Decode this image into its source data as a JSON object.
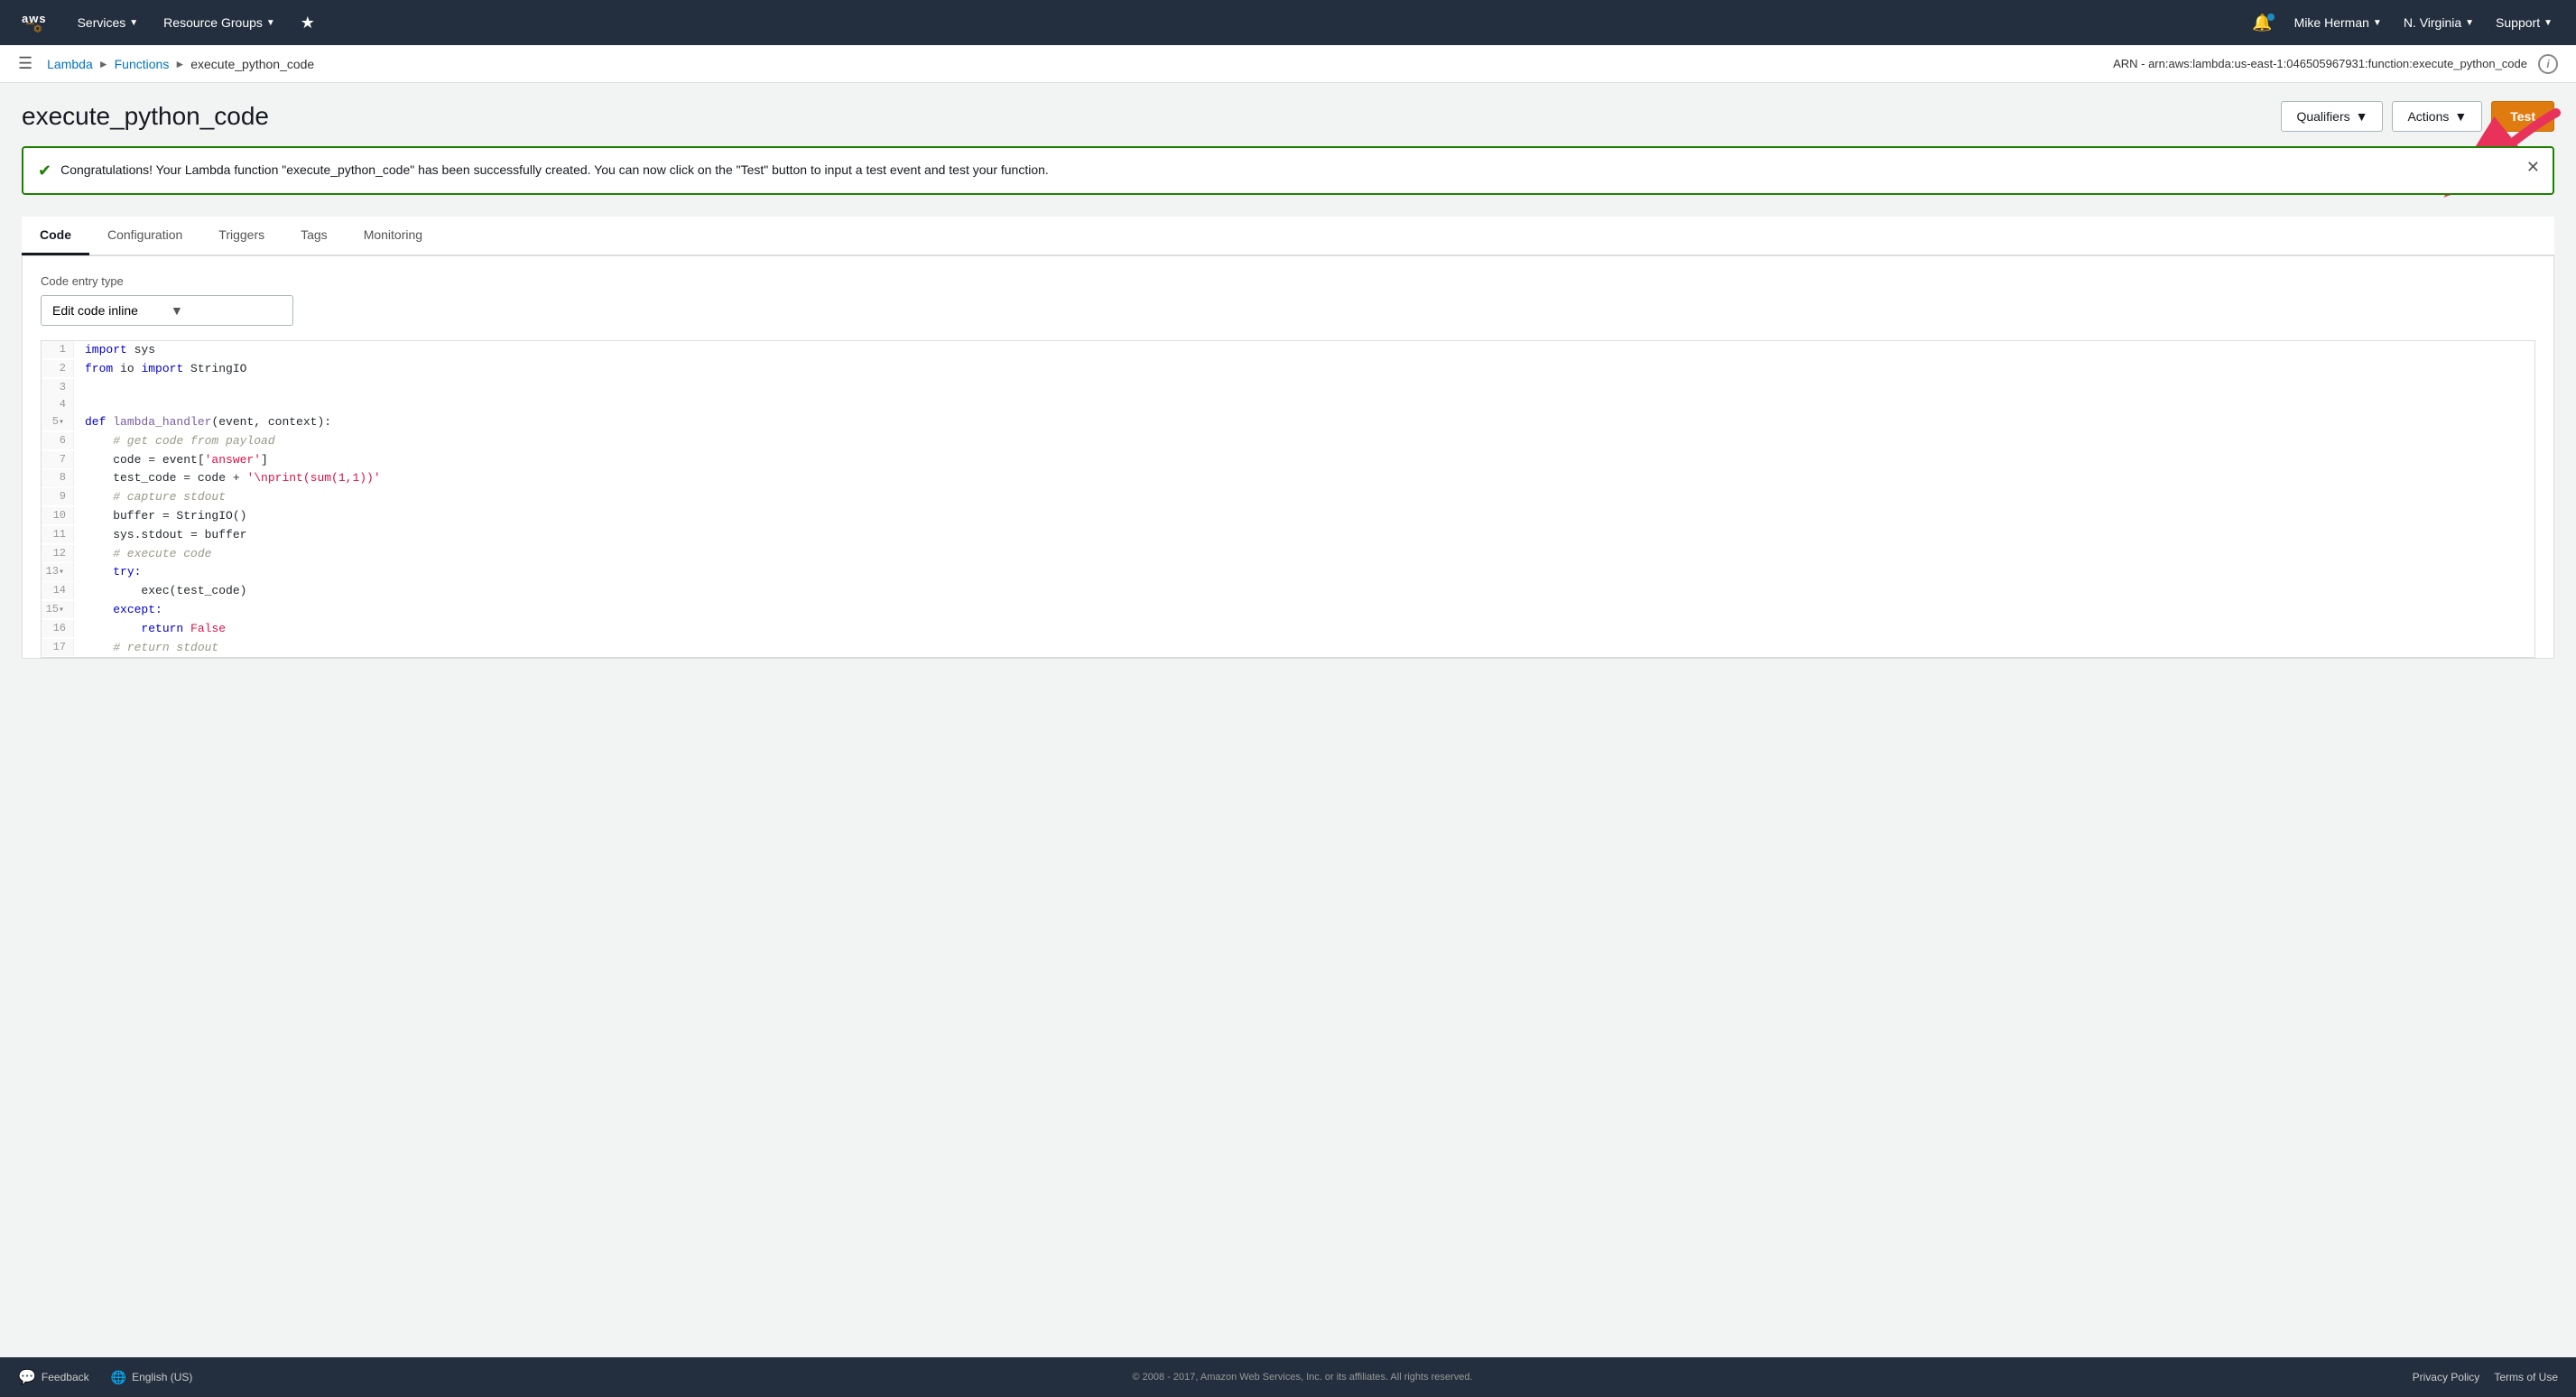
{
  "topnav": {
    "services_label": "Services",
    "resource_groups_label": "Resource Groups",
    "bell_count": "",
    "user_name": "Mike Herman",
    "region": "N. Virginia",
    "support": "Support"
  },
  "breadcrumb": {
    "lambda": "Lambda",
    "functions": "Functions",
    "current": "execute_python_code"
  },
  "arn": "ARN - arn:aws:lambda:us-east-1:046505967931:function:execute_python_code",
  "page": {
    "title": "execute_python_code",
    "qualifiers_btn": "Qualifiers",
    "actions_btn": "Actions",
    "test_btn": "Test"
  },
  "success_banner": {
    "text": "Congratulations! Your Lambda function \"execute_python_code\" has been successfully created. You can now click on the \"Test\" button to input a test event and test your function."
  },
  "tabs": [
    {
      "label": "Code",
      "active": true
    },
    {
      "label": "Configuration",
      "active": false
    },
    {
      "label": "Triggers",
      "active": false
    },
    {
      "label": "Tags",
      "active": false
    },
    {
      "label": "Monitoring",
      "active": false
    }
  ],
  "code_panel": {
    "entry_type_label": "Code entry type",
    "entry_type_value": "Edit code inline"
  },
  "code_lines": [
    {
      "num": "1",
      "content": "import sys",
      "tokens": [
        {
          "t": "kw-blue",
          "v": "import"
        },
        {
          "t": "",
          "v": " sys"
        }
      ]
    },
    {
      "num": "2",
      "content": "from io import StringIO",
      "tokens": [
        {
          "t": "kw-blue",
          "v": "from"
        },
        {
          "t": "",
          "v": " io "
        },
        {
          "t": "kw-blue",
          "v": "import"
        },
        {
          "t": "",
          "v": " StringIO"
        }
      ]
    },
    {
      "num": "3",
      "content": "",
      "tokens": []
    },
    {
      "num": "4",
      "content": "",
      "tokens": []
    },
    {
      "num": "5",
      "content": "def lambda_handler(event, context):",
      "fold": true,
      "tokens": [
        {
          "t": "kw-blue",
          "v": "def"
        },
        {
          "t": "",
          "v": " lambda_handler(event, context):"
        }
      ]
    },
    {
      "num": "6",
      "content": "    # get code from payload",
      "tokens": [
        {
          "t": "kw-comment",
          "v": "    # get code from payload"
        }
      ]
    },
    {
      "num": "7",
      "content": "    code = event['answer']",
      "tokens": [
        {
          "t": "",
          "v": "    code = event["
        },
        {
          "t": "kw-string",
          "v": "'answer'"
        },
        {
          "t": "",
          "v": "]"
        }
      ]
    },
    {
      "num": "8",
      "content": "    test_code = code + '\\nprint(sum(1,1))'",
      "tokens": [
        {
          "t": "",
          "v": "    test_code = code + "
        },
        {
          "t": "kw-string",
          "v": "'\\nprint(sum(1,1))'"
        }
      ]
    },
    {
      "num": "9",
      "content": "    # capture stdout",
      "tokens": [
        {
          "t": "kw-comment",
          "v": "    # capture stdout"
        }
      ]
    },
    {
      "num": "10",
      "content": "    buffer = StringIO()",
      "tokens": [
        {
          "t": "",
          "v": "    buffer = StringIO()"
        }
      ]
    },
    {
      "num": "11",
      "content": "    sys.stdout = buffer",
      "tokens": [
        {
          "t": "",
          "v": "    sys.stdout = buffer"
        }
      ]
    },
    {
      "num": "12",
      "content": "    # execute code",
      "tokens": [
        {
          "t": "kw-comment",
          "v": "    # execute code"
        }
      ]
    },
    {
      "num": "13",
      "content": "    try:",
      "fold": true,
      "tokens": [
        {
          "t": "",
          "v": "    "
        },
        {
          "t": "kw-blue",
          "v": "try:"
        }
      ]
    },
    {
      "num": "14",
      "content": "        exec(test_code)",
      "tokens": [
        {
          "t": "",
          "v": "        exec(test_code)"
        }
      ]
    },
    {
      "num": "15",
      "content": "    except:",
      "fold": true,
      "tokens": [
        {
          "t": "",
          "v": "    "
        },
        {
          "t": "kw-blue",
          "v": "except:"
        }
      ]
    },
    {
      "num": "16",
      "content": "        return False",
      "tokens": [
        {
          "t": "",
          "v": "        "
        },
        {
          "t": "kw-blue",
          "v": "return"
        },
        {
          "t": "kw-string",
          "v": " False"
        }
      ]
    },
    {
      "num": "17",
      "content": "    # return stdout",
      "tokens": [
        {
          "t": "kw-comment",
          "v": "    # return stdout"
        }
      ]
    }
  ],
  "footer": {
    "feedback": "Feedback",
    "language": "English (US)",
    "copyright": "© 2008 - 2017, Amazon Web Services, Inc. or its affiliates. All rights reserved.",
    "privacy_policy": "Privacy Policy",
    "terms_of_use": "Terms of Use"
  }
}
